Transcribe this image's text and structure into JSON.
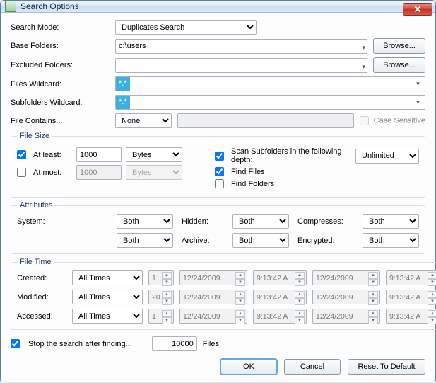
{
  "window": {
    "title": "Search Options"
  },
  "labels": {
    "search_mode": "Search Mode:",
    "base_folders": "Base Folders:",
    "excluded_folders": "Excluded Folders:",
    "files_wildcard": "Files Wildcard:",
    "subfolders_wildcard": "Subfolders Wildcard:",
    "file_contains": "File Contains...",
    "case_sensitive": "Case Sensitive",
    "browse": "Browse..."
  },
  "search_mode": {
    "selected": "Duplicates Search"
  },
  "base_folders": {
    "value": "c:\\users"
  },
  "excluded_folders": {
    "value": ""
  },
  "wildcards": {
    "files_token": "*.*",
    "subfolders_token": "*.*"
  },
  "file_contains": {
    "mode_selected": "None",
    "text": "",
    "case_sensitive": false
  },
  "filesize": {
    "legend": "File Size",
    "at_least_label": "At least:",
    "at_least_checked": true,
    "at_least_value": "1000",
    "at_least_unit": "Bytes",
    "at_most_label": "At most:",
    "at_most_checked": false,
    "at_most_value": "1000",
    "at_most_unit": "Bytes"
  },
  "scan": {
    "scan_subfolders_label": "Scan Subfolders in the following depth:",
    "scan_subfolders_checked": true,
    "depth_selected": "Unlimited",
    "find_files_label": "Find Files",
    "find_files_checked": true,
    "find_folders_label": "Find Folders",
    "find_folders_checked": false
  },
  "attributes": {
    "legend": "Attributes",
    "system_label": "System:",
    "hidden_label": "Hidden:",
    "compresses_label": "Compresses:",
    "archive_label": "Archive:",
    "encrypted_label": "Encrypted:",
    "system": "Both",
    "row2_left": "Both",
    "hidden": "Both",
    "archive": "Both",
    "compresses": "Both",
    "encrypted": "Both"
  },
  "filetime": {
    "legend": "File Time",
    "created_label": "Created:",
    "modified_label": "Modified:",
    "accessed_label": "Accessed:",
    "created": {
      "mode": "All Times",
      "n": "1",
      "d1": "12/24/2009",
      "t1": "9:13:42 A",
      "d2": "12/24/2009",
      "t2": "9:13:42 A"
    },
    "modified": {
      "mode": "All Times",
      "n": "20",
      "d1": "12/24/2009",
      "t1": "9:13:42 A",
      "d2": "12/24/2009",
      "t2": "9:13:42 A"
    },
    "accessed": {
      "mode": "All Times",
      "n": "1",
      "d1": "12/24/2009",
      "t1": "9:13:42 A",
      "d2": "12/24/2009",
      "t2": "9:13:42 A"
    }
  },
  "stop_after": {
    "checked": true,
    "label": "Stop the search after finding...",
    "count": "10000",
    "unit": "Files"
  },
  "buttons": {
    "ok": "OK",
    "cancel": "Cancel",
    "reset": "Reset To Default"
  }
}
